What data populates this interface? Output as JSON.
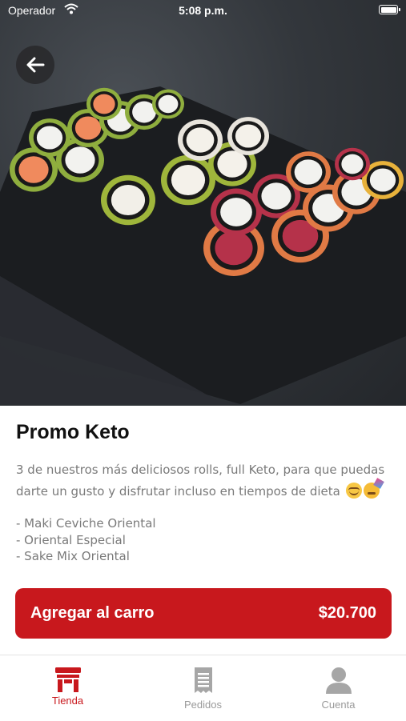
{
  "status_bar": {
    "carrier": "Operador",
    "time": "5:08 p.m."
  },
  "product": {
    "title": "Promo Keto",
    "description": "3 de nuestros más deliciosos rolls, full Keto, para que puedas darte un gusto y disfrutar incluso en tiempos de dieta",
    "description_emojis": [
      "relaxed-face",
      "partying-face"
    ],
    "items": [
      "- Maki Ceviche Oriental",
      "- Oriental Especial",
      "- Sake Mix Oriental"
    ]
  },
  "cart_button": {
    "label": "Agregar al carro",
    "price": "$20.700"
  },
  "tab_bar": {
    "tabs": [
      {
        "label": "Tienda",
        "icon": "store-icon",
        "active": true
      },
      {
        "label": "Pedidos",
        "icon": "receipt-icon",
        "active": false
      },
      {
        "label": "Cuenta",
        "icon": "user-icon",
        "active": false
      }
    ]
  },
  "colors": {
    "accent": "#c8181d",
    "title": "#111111",
    "body_text": "#7a7a7a",
    "inactive_tab": "#9a9a9a"
  }
}
